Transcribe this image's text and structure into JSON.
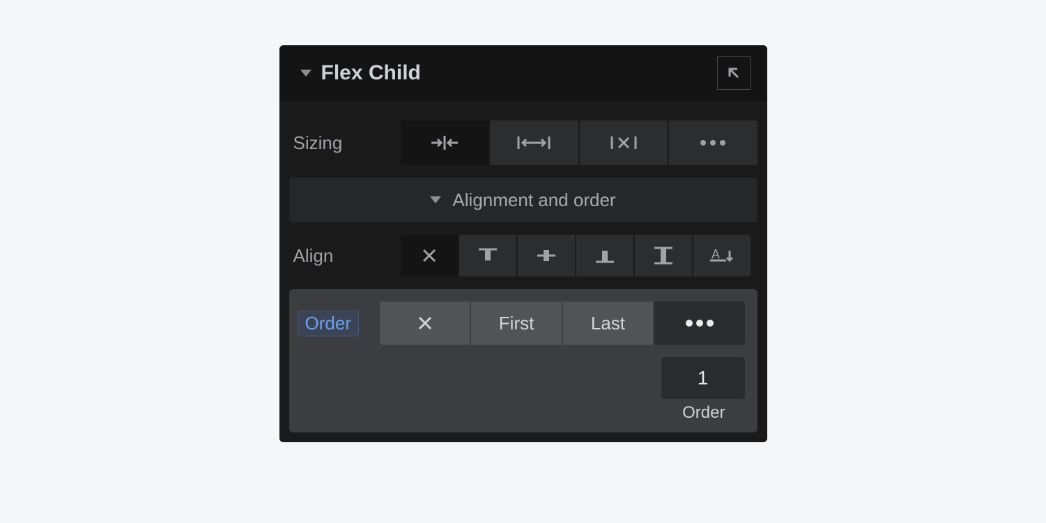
{
  "panel": {
    "title": "Flex Child",
    "go_to_parent_tooltip": "Select parent"
  },
  "sizing": {
    "label": "Sizing",
    "options": [
      {
        "name": "shrink",
        "active": true
      },
      {
        "name": "grow",
        "active": false
      },
      {
        "name": "dont-shrink",
        "active": false
      },
      {
        "name": "more",
        "active": false
      }
    ]
  },
  "alignment_expander": {
    "label": "Alignment and order",
    "expanded": true
  },
  "align": {
    "label": "Align",
    "options": [
      {
        "name": "auto",
        "active": true
      },
      {
        "name": "start",
        "active": false
      },
      {
        "name": "center",
        "active": false
      },
      {
        "name": "end",
        "active": false
      },
      {
        "name": "stretch",
        "active": false
      },
      {
        "name": "baseline",
        "active": false
      }
    ]
  },
  "order": {
    "label": "Order",
    "options": [
      {
        "name": "default",
        "label": "",
        "active": false
      },
      {
        "name": "first",
        "label": "First",
        "active": false
      },
      {
        "name": "last",
        "label": "Last",
        "active": false
      },
      {
        "name": "custom",
        "label": "",
        "active": true
      }
    ],
    "value": "1",
    "value_caption": "Order"
  }
}
